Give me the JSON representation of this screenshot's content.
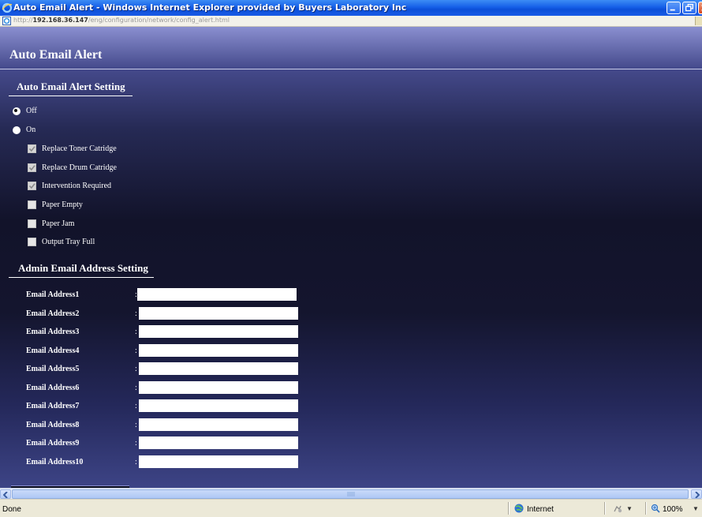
{
  "window": {
    "title": "Auto Email Alert - Windows Internet Explorer provided by Buyers Laboratory Inc"
  },
  "address": {
    "scheme": "http://",
    "host": "192.168.36.147",
    "path": "/eng/configuration/network/config_alert.html"
  },
  "page": {
    "title": "Auto Email Alert",
    "alert_section": {
      "title": "Auto Email Alert Setting",
      "radios": [
        {
          "label": "Off",
          "checked": true
        },
        {
          "label": "On",
          "checked": false
        }
      ],
      "options": [
        {
          "label": "Replace Toner Catridge",
          "checked": true
        },
        {
          "label": "Replace Drum Catridge",
          "checked": true
        },
        {
          "label": "Intervention Required",
          "checked": true
        },
        {
          "label": "Paper Empty",
          "checked": false
        },
        {
          "label": "Paper Jam",
          "checked": false
        },
        {
          "label": "Output Tray Full",
          "checked": false
        }
      ]
    },
    "admin_section": {
      "title": "Admin Email Address Setting",
      "separator": ":",
      "addresses": [
        {
          "label": "Email Address1",
          "value": ""
        },
        {
          "label": "Email Address2",
          "value": ""
        },
        {
          "label": "Email Address3",
          "value": ""
        },
        {
          "label": "Email Address4",
          "value": ""
        },
        {
          "label": "Email Address5",
          "value": ""
        },
        {
          "label": "Email Address6",
          "value": ""
        },
        {
          "label": "Email Address7",
          "value": ""
        },
        {
          "label": "Email Address8",
          "value": ""
        },
        {
          "label": "Email Address9",
          "value": ""
        },
        {
          "label": "Email Address10",
          "value": ""
        }
      ]
    }
  },
  "status": {
    "text": "Done",
    "zone": "Internet",
    "zoom": "100%"
  },
  "colors": {
    "titlebar": "#1660e8",
    "page_top": "#8a8fd0",
    "page_mid": "#12132a",
    "page_bottom": "#3d4486"
  },
  "icons": [
    "ie-logo-icon",
    "minimize-icon",
    "restore-icon",
    "close-icon",
    "page-icon",
    "go-icon",
    "scroll-left-icon",
    "scroll-right-icon",
    "globe-icon",
    "protected-mode-icon",
    "zoom-icon"
  ]
}
